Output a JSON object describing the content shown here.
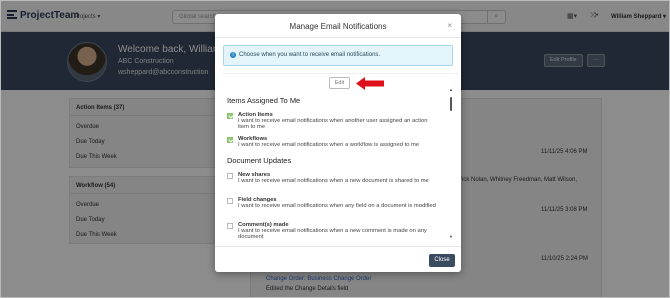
{
  "nav": {
    "logo": "ProjectTeam",
    "projects_label": "Projects",
    "search_placeholder": "Global search",
    "user": "William Sheppard"
  },
  "hero": {
    "welcome": "Welcome back, William",
    "company": "ABC Construction",
    "email": "wsheppard@abcconstruction",
    "edit_profile": "Edit Profile",
    "more": "···"
  },
  "action_items": {
    "title": "Action Items (37)",
    "rows": [
      "Overdue",
      "Due Today",
      "Due This Week"
    ]
  },
  "workflow": {
    "title": "Workflow (54)",
    "rows": [
      "Overdue",
      "Due Today",
      "Due This Week"
    ]
  },
  "feed": {
    "ts1": "11/11/25 4:06 PM",
    "names": "atrick Nolan, Whitney Freedman, Matt Wilson,",
    "ts2": "11/11/25 3:08 PM",
    "ts3": "11/10/25 2:24 PM",
    "link": "Change Order: Business Change Order",
    "edited": "Edited the Change Details field"
  },
  "modal": {
    "title": "Manage Email Notifications",
    "close_x": "×",
    "info": "Choose when you want to receive email notifications.",
    "edit": "Edit",
    "sections": [
      {
        "title": "Items Assigned To Me",
        "options": [
          {
            "name": "Action Items",
            "desc": "I want to receive email notifications when another user assigned an action item to me",
            "checked": true
          },
          {
            "name": "Workflows",
            "desc": "I want to receive email notifications when a workflow is assigned to me",
            "checked": true
          }
        ]
      },
      {
        "title": "Document Updates",
        "options": [
          {
            "name": "New shares",
            "desc": "I want to receive email notifications when a new document is shared to me",
            "checked": false
          },
          {
            "name": "Field changes",
            "desc": "I want to receive email notifications when any field on a document is modified",
            "checked": false
          },
          {
            "name": "Comment(s) made",
            "desc": "I want to receive email notifications when a new comment is made on any document",
            "checked": false
          }
        ]
      }
    ],
    "close_button": "Close"
  },
  "colors": {
    "accent": "#3a4a5f",
    "arrow": "#e0111b",
    "check": "#9ccf7e",
    "link": "#2a64c5"
  }
}
